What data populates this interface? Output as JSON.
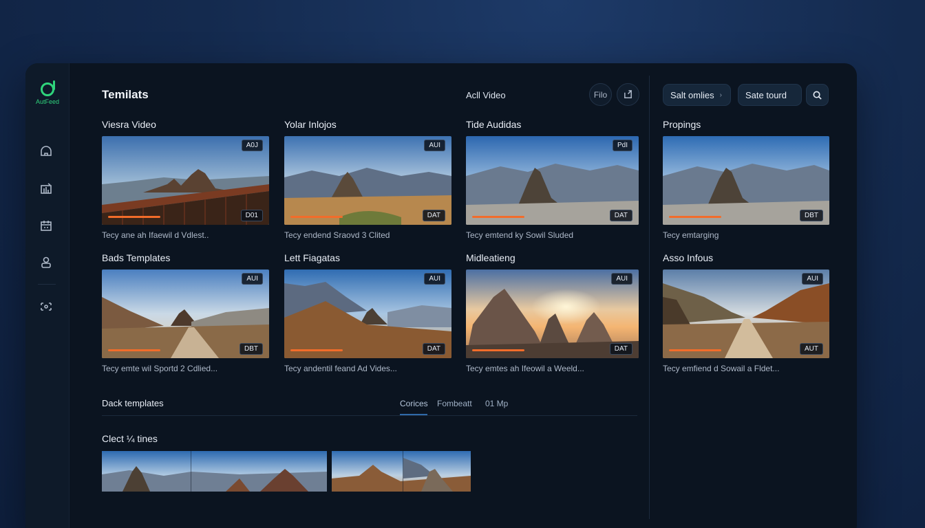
{
  "app": {
    "logo_text": "AutFeed"
  },
  "header": {
    "title": "Temilats",
    "add_video": "Acll Video",
    "file_btn": "Filo",
    "sort_select": "Salt omlies",
    "sort_chevron": "›",
    "state_btn": "Sate tourd"
  },
  "sidebar": {
    "items": [
      {
        "icon": "home-icon"
      },
      {
        "icon": "analytics-icon"
      },
      {
        "icon": "calendar-icon"
      },
      {
        "icon": "user-icon"
      },
      {
        "icon": "share-icon"
      }
    ]
  },
  "grid": {
    "row1": [
      {
        "title": "Viesra Video",
        "badge_top": "A0J",
        "badge_bottom": "D01",
        "caption": "Tecy ane ah Ifaewil d Vdlest.."
      },
      {
        "title": "Yolar Inlojos",
        "badge_top": "AUI",
        "badge_bottom": "DAT",
        "caption": "Tecy endend Sraovd 3 Clited"
      },
      {
        "title": "Tide Audidas",
        "badge_top": "PdI",
        "badge_bottom": "DAT",
        "caption": "Tecy emtend ky Sowil Sluded"
      },
      {
        "title": "Propings",
        "badge_top": "",
        "badge_bottom": "DBT",
        "caption": "Tecy emtarging"
      }
    ],
    "row2": [
      {
        "title": "Bads Templates",
        "badge_top": "AUI",
        "badge_bottom": "DBT",
        "caption": "Tecy emte wil Sportd 2 Cdlied..."
      },
      {
        "title": "Lett Fiagatas",
        "badge_top": "AUI",
        "badge_bottom": "DAT",
        "caption": "Tecy andentil feand Ad Vides..."
      },
      {
        "title": "Midleatieng",
        "badge_top": "AUI",
        "badge_bottom": "DAT",
        "caption": "Tecy emtes ah Ifeowil a Weeld..."
      },
      {
        "title": "Asso Infous",
        "badge_top": "AUI",
        "badge_bottom": "AUT",
        "caption": "Tecy emfiend d Sowail a Fldet..."
      }
    ]
  },
  "dock": {
    "label": "Dack templates",
    "tabs": [
      "Corices",
      "Fombeatt",
      "01 Mp"
    ],
    "clect_label": "Clect ¼ tines"
  },
  "colors": {
    "accent": "#2fd47c",
    "progress": "#f26c2a",
    "tab_active": "#2f6aa8"
  }
}
